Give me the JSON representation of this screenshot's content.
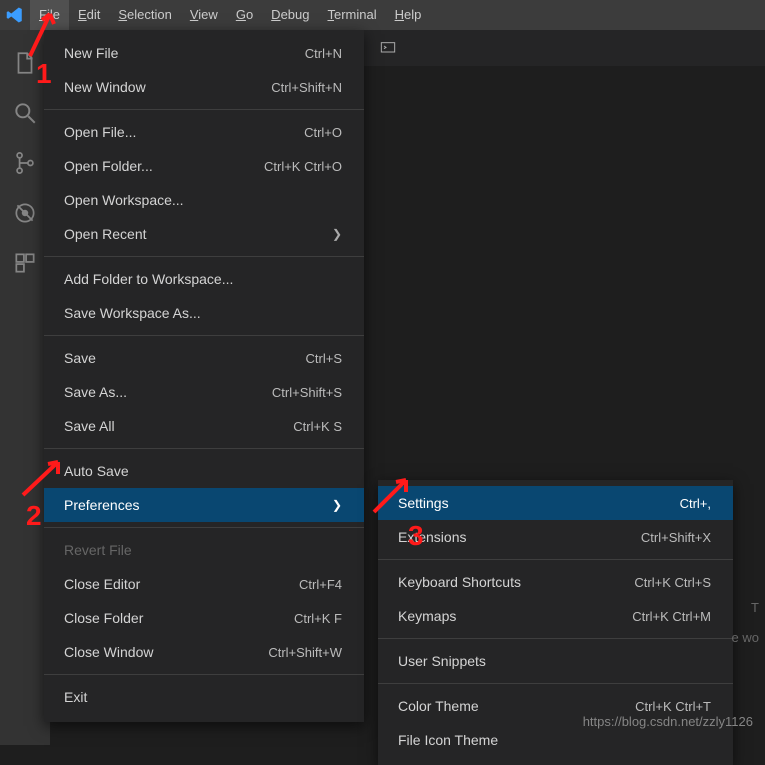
{
  "menubar": {
    "items": [
      {
        "label": "File",
        "u": "F",
        "active": true
      },
      {
        "label": "Edit",
        "u": "E"
      },
      {
        "label": "Selection",
        "u": "S"
      },
      {
        "label": "View",
        "u": "V"
      },
      {
        "label": "Go",
        "u": "G"
      },
      {
        "label": "Debug",
        "u": "D"
      },
      {
        "label": "Terminal",
        "u": "T"
      },
      {
        "label": "Help",
        "u": "H"
      }
    ]
  },
  "file_menu": {
    "groups": [
      [
        {
          "label": "New File",
          "shortcut": "Ctrl+N"
        },
        {
          "label": "New Window",
          "shortcut": "Ctrl+Shift+N"
        }
      ],
      [
        {
          "label": "Open File...",
          "shortcut": "Ctrl+O"
        },
        {
          "label": "Open Folder...",
          "shortcut": "Ctrl+K Ctrl+O"
        },
        {
          "label": "Open Workspace..."
        },
        {
          "label": "Open Recent",
          "submenu": true
        }
      ],
      [
        {
          "label": "Add Folder to Workspace..."
        },
        {
          "label": "Save Workspace As..."
        }
      ],
      [
        {
          "label": "Save",
          "shortcut": "Ctrl+S"
        },
        {
          "label": "Save As...",
          "shortcut": "Ctrl+Shift+S"
        },
        {
          "label": "Save All",
          "shortcut": "Ctrl+K S"
        }
      ],
      [
        {
          "label": "Auto Save"
        },
        {
          "label": "Preferences",
          "submenu": true,
          "hover": true
        }
      ],
      [
        {
          "label": "Revert File",
          "disabled": true
        },
        {
          "label": "Close Editor",
          "shortcut": "Ctrl+F4"
        },
        {
          "label": "Close Folder",
          "shortcut": "Ctrl+K F"
        },
        {
          "label": "Close Window",
          "shortcut": "Ctrl+Shift+W"
        }
      ],
      [
        {
          "label": "Exit"
        }
      ]
    ]
  },
  "preferences_submenu": {
    "groups": [
      [
        {
          "label": "Settings",
          "shortcut": "Ctrl+,",
          "hover": true
        },
        {
          "label": "Extensions",
          "shortcut": "Ctrl+Shift+X"
        }
      ],
      [
        {
          "label": "Keyboard Shortcuts",
          "shortcut": "Ctrl+K Ctrl+S"
        },
        {
          "label": "Keymaps",
          "shortcut": "Ctrl+K Ctrl+M"
        }
      ],
      [
        {
          "label": "User Snippets"
        }
      ],
      [
        {
          "label": "Color Theme",
          "shortcut": "Ctrl+K Ctrl+T"
        },
        {
          "label": "File Icon Theme"
        }
      ]
    ]
  },
  "annotations": {
    "one": "1",
    "two": "2",
    "three": "3"
  },
  "watermark": "https://blog.csdn.net/zzly1126",
  "side_text_top": "T",
  "side_text_bot": "e wo"
}
